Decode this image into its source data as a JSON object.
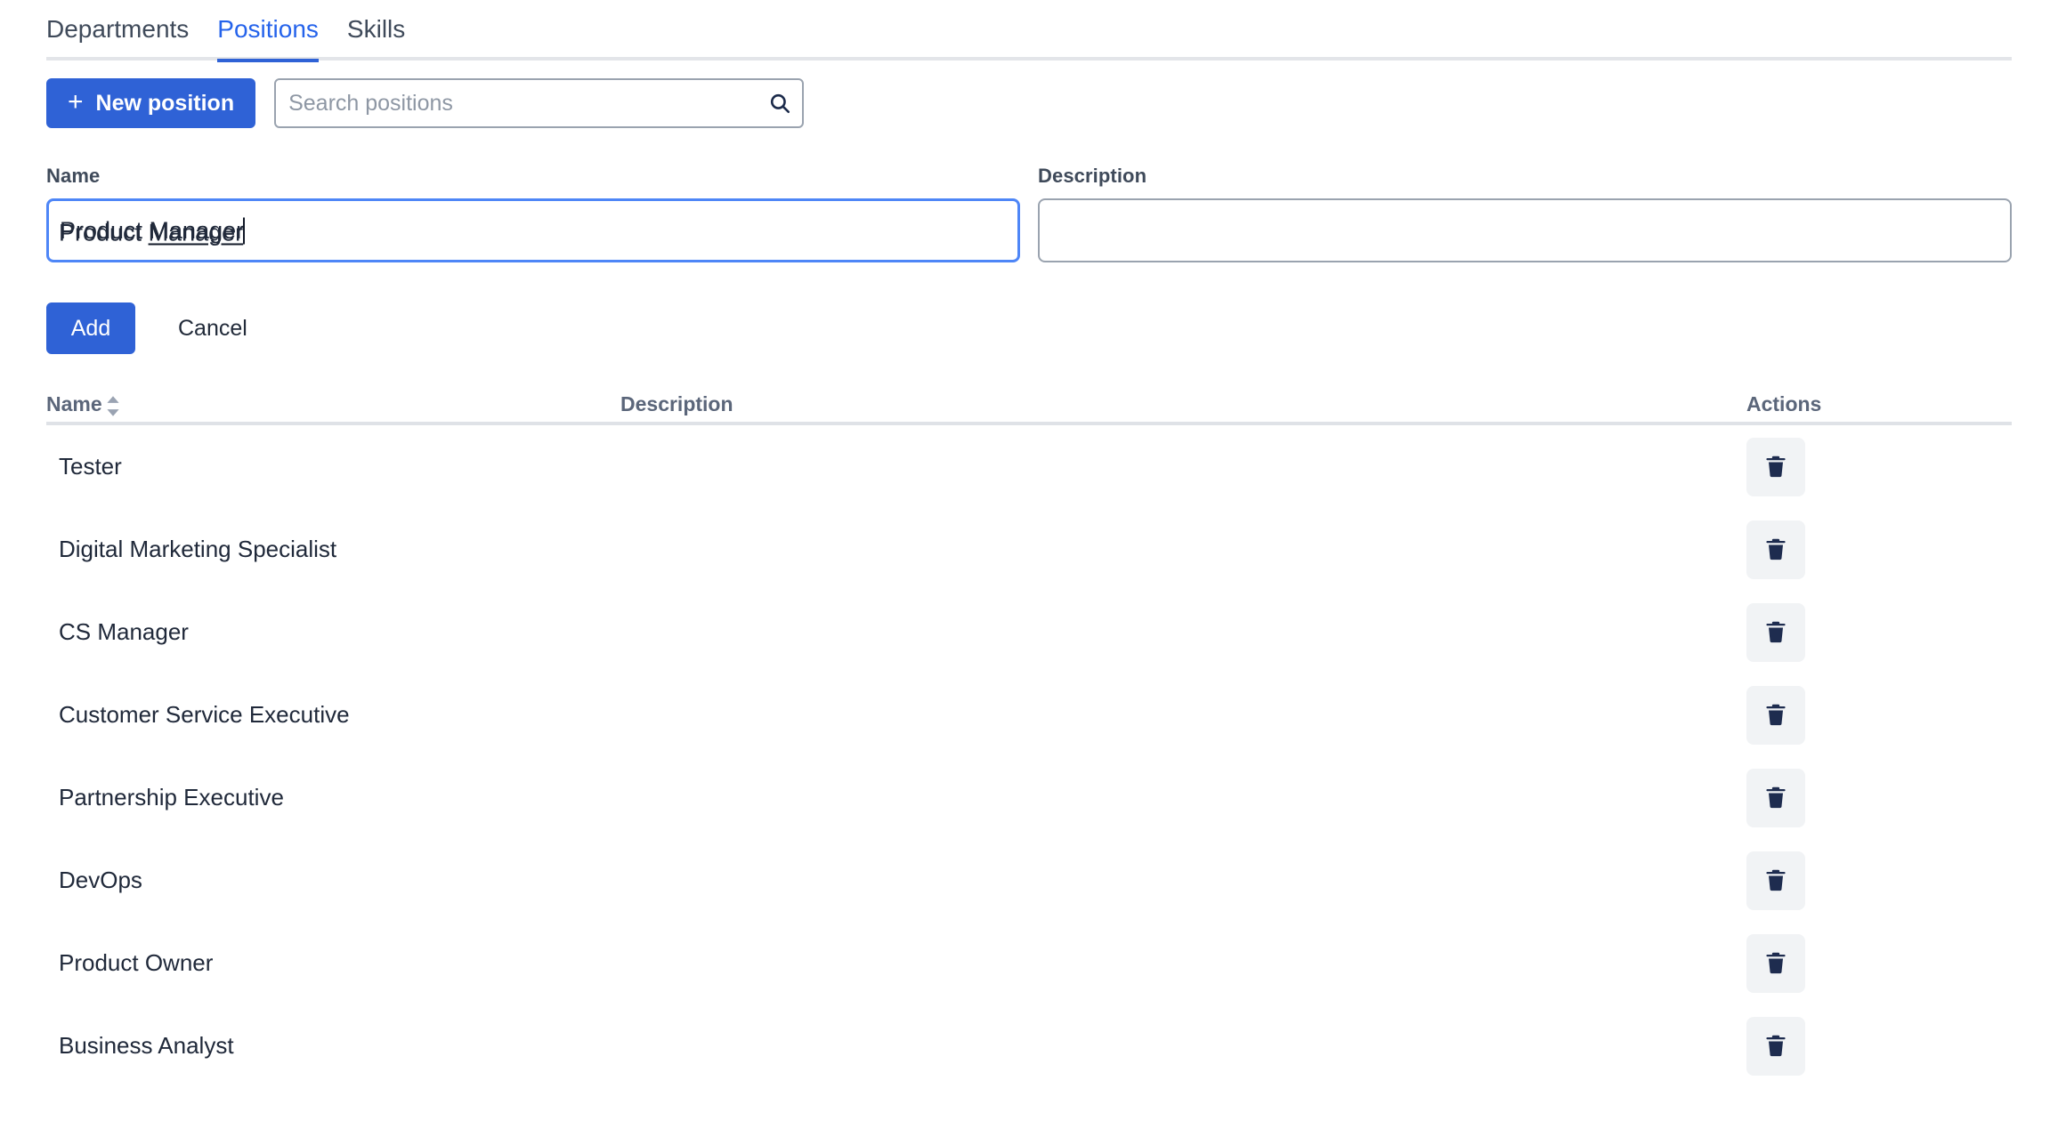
{
  "tabs": [
    {
      "label": "Departments",
      "active": false
    },
    {
      "label": "Positions",
      "active": true
    },
    {
      "label": "Skills",
      "active": false
    }
  ],
  "toolbar": {
    "new_button_label": "New position",
    "new_button_icon": "plus-icon",
    "search_placeholder": "Search positions",
    "search_value": "",
    "search_icon": "search-icon"
  },
  "form": {
    "name_label": "Name",
    "name_value": "Product Manager",
    "name_value_prefix": "Product ",
    "name_value_suggestion": "Manager",
    "name_focused": true,
    "description_label": "Description",
    "description_value": "",
    "add_label": "Add",
    "cancel_label": "Cancel"
  },
  "table": {
    "columns": [
      {
        "key": "name",
        "label": "Name",
        "sortable": true,
        "sort_icon": "sort-updown-icon"
      },
      {
        "key": "description",
        "label": "Description",
        "sortable": false
      },
      {
        "key": "actions",
        "label": "Actions",
        "sortable": false
      }
    ],
    "row_action_icon": "trash-icon",
    "rows": [
      {
        "name": "Tester",
        "description": ""
      },
      {
        "name": "Digital Marketing Specialist",
        "description": ""
      },
      {
        "name": "CS Manager",
        "description": ""
      },
      {
        "name": "Customer Service Executive",
        "description": ""
      },
      {
        "name": "Partnership Executive",
        "description": ""
      },
      {
        "name": "DevOps",
        "description": ""
      },
      {
        "name": "Product Owner",
        "description": ""
      },
      {
        "name": "Business Analyst",
        "description": ""
      }
    ]
  },
  "colors": {
    "accent_blue": "#2f62d6",
    "active_tab_text": "#2563eb",
    "focus_border": "#4e86f7",
    "text_dark": "#20293a",
    "text_muted": "#5b667a",
    "border_gray": "#9aa3af",
    "divider": "#dfe2e7",
    "icon_button_bg": "#f1f3f5",
    "icon_navy": "#1e2c4f"
  }
}
